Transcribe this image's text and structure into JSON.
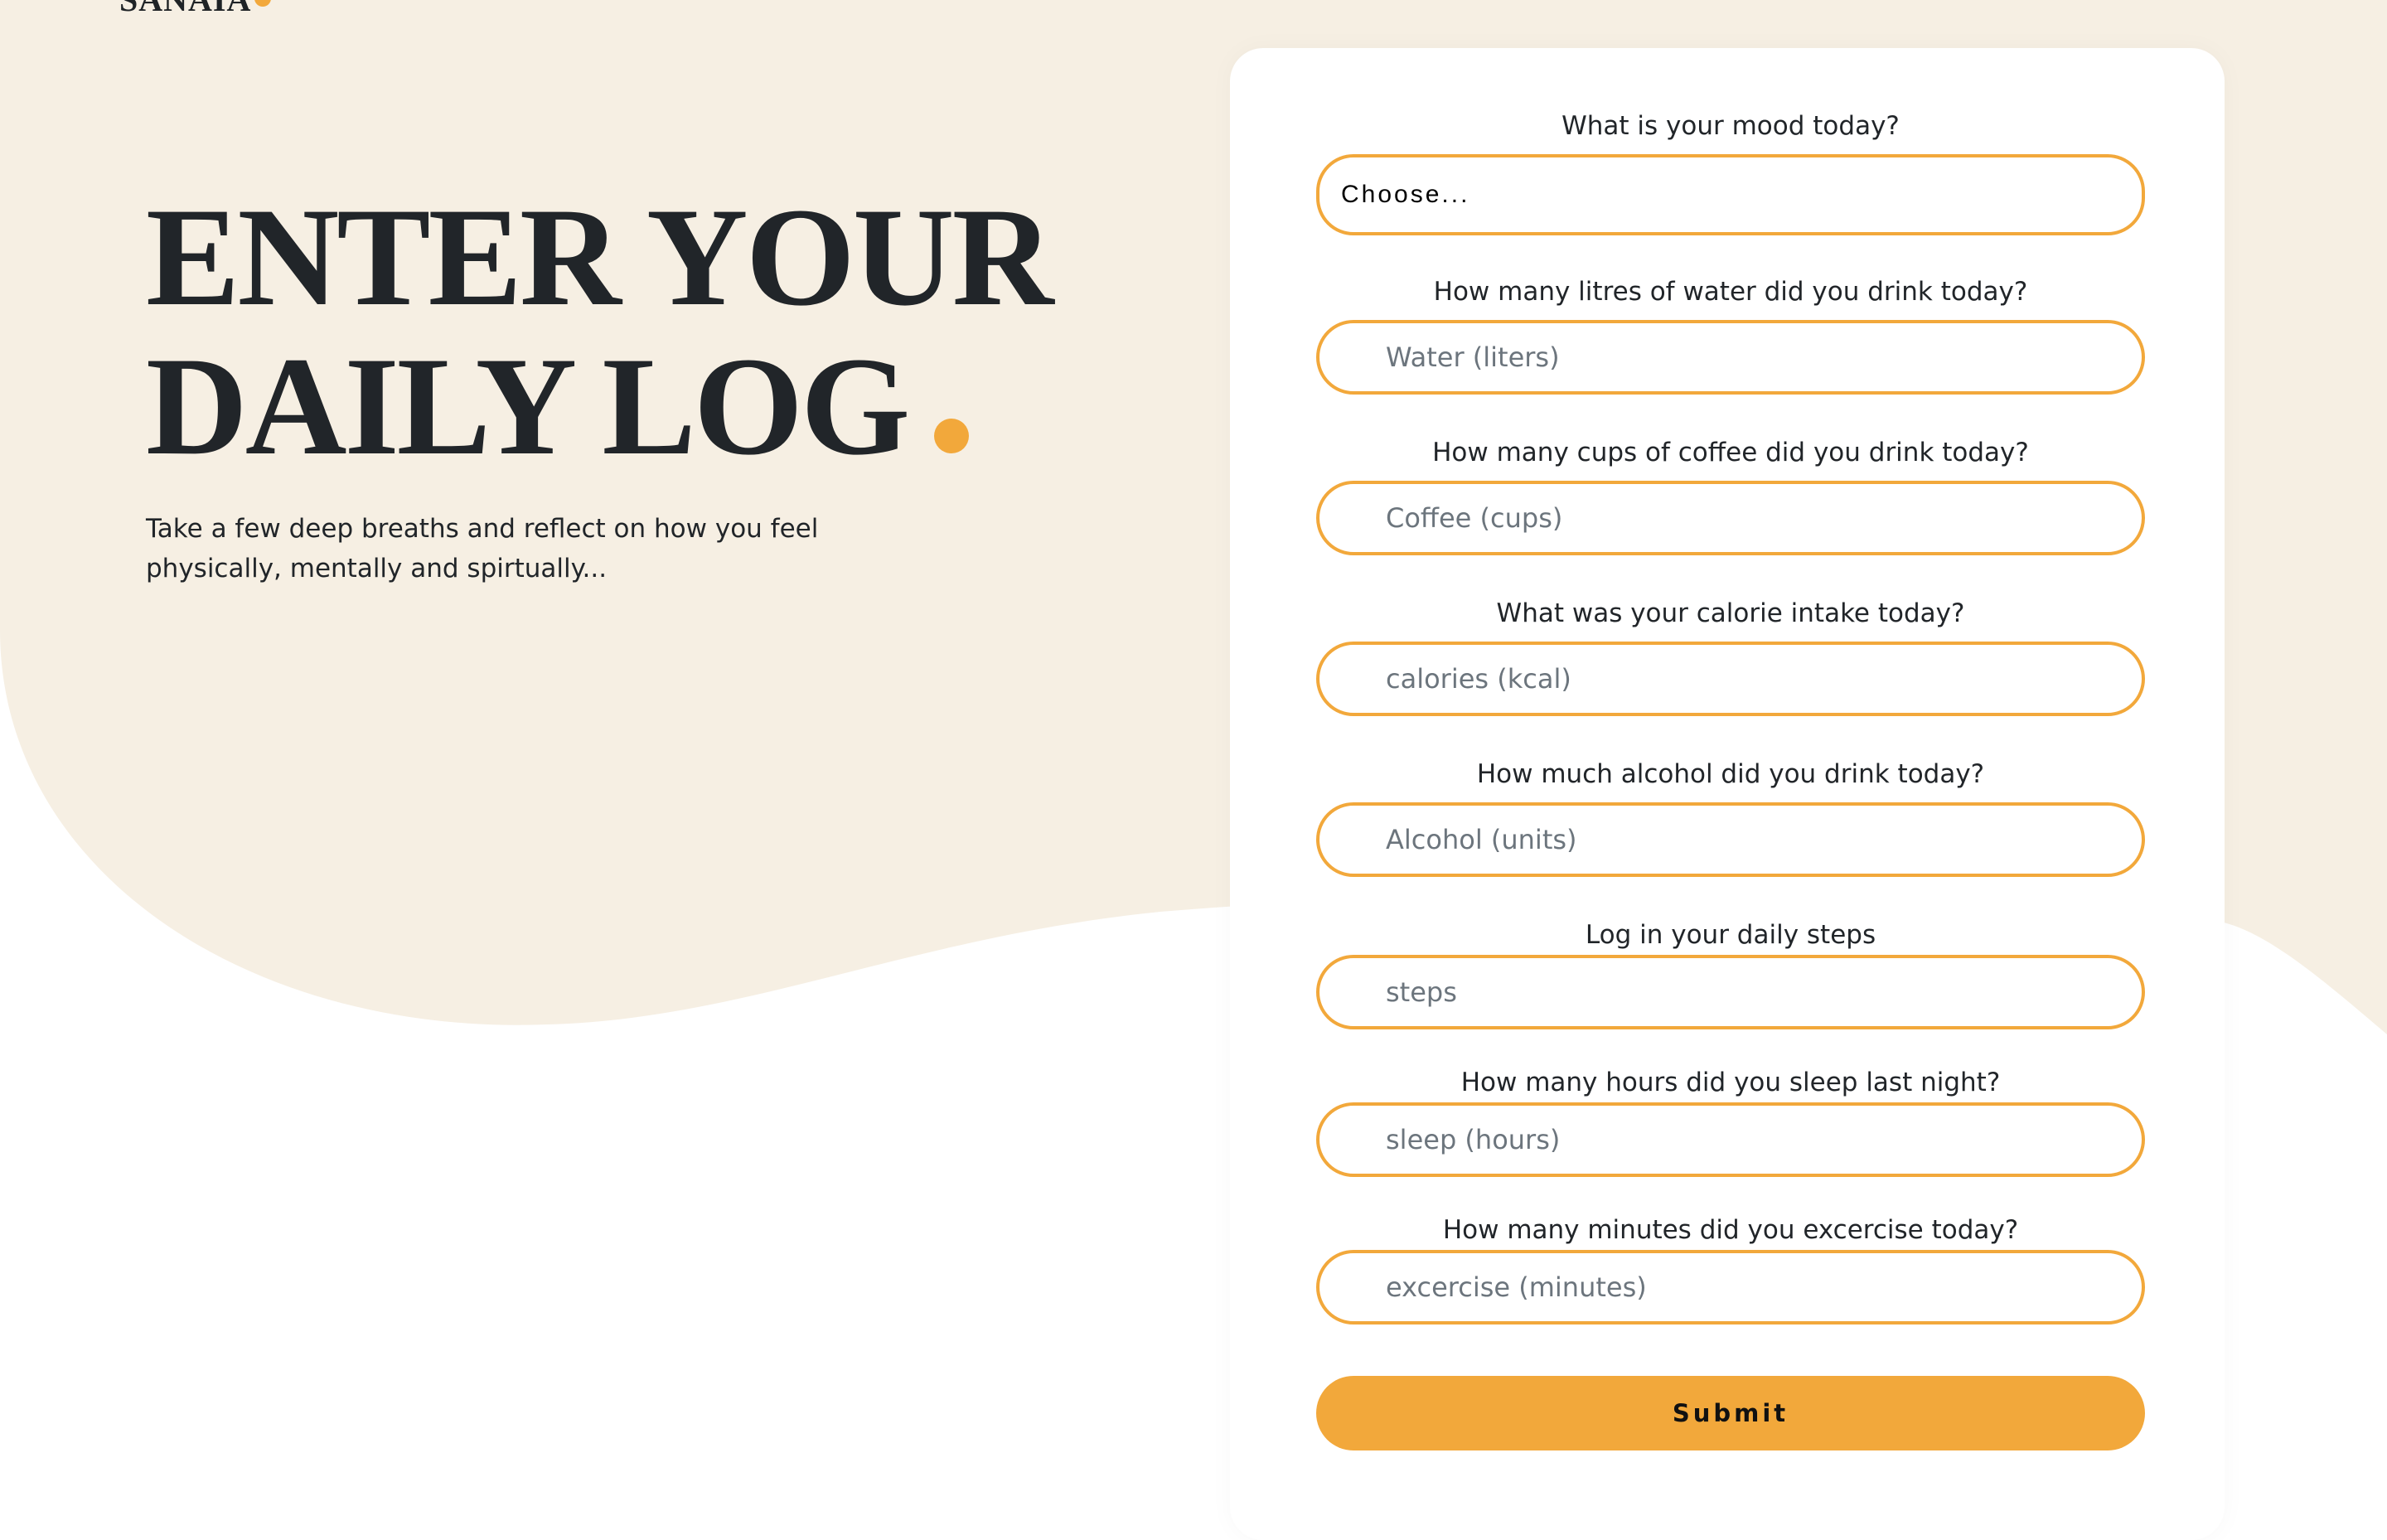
{
  "brand": {
    "logo_text": "SANAIA",
    "accent_color": "#f2a83b",
    "background_color": "#f6efe3"
  },
  "hero": {
    "title_line1": "ENTER YOUR",
    "title_line2": "DAILY LOG",
    "subtitle": "Take a few deep breaths and reflect on how you feel physically, mentally and spirtually..."
  },
  "form": {
    "mood": {
      "question": "What is your mood today?",
      "selected": "Choose..."
    },
    "fields": [
      {
        "question": "How many litres of water did you drink today?",
        "placeholder": "Water (liters)"
      },
      {
        "question": "How many cups of coffee did you drink today?",
        "placeholder": "Coffee (cups)"
      },
      {
        "question": "What was your calorie intake today?",
        "placeholder": "calories (kcal)"
      },
      {
        "question": "How much alcohol did you drink today?",
        "placeholder": "Alcohol (units)"
      },
      {
        "question": "Log in your daily steps",
        "placeholder": "steps"
      },
      {
        "question": "How many hours did you sleep last night?",
        "placeholder": "sleep (hours)"
      },
      {
        "question": "How many minutes did you excercise today?",
        "placeholder": "excercise (minutes)"
      }
    ],
    "submit_label": "Submit"
  }
}
